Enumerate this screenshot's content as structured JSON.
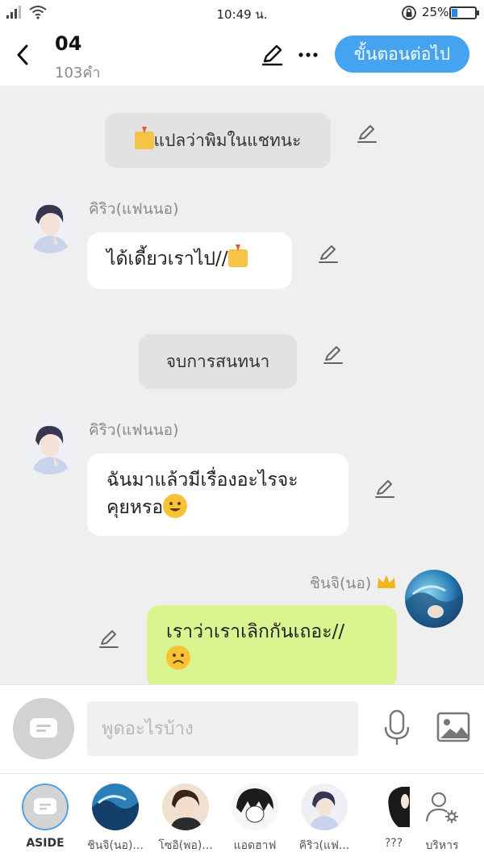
{
  "status_bar": {
    "time": "10:49 น.",
    "battery": "25%",
    "battery_level": 0.25
  },
  "header": {
    "title": "04",
    "subtitle": "103คำ",
    "next_label": "ขั้นตอนต่อไป"
  },
  "messages": [
    {
      "type": "narration",
      "text": "แปลว่าพิมในแชทนะ",
      "icon": "inbox-download-emoji"
    },
    {
      "type": "left",
      "name": "คิริว(แฟนนอ)",
      "text": "ได้เดี้ยวเราไป//",
      "icon": "inbox-download-emoji"
    },
    {
      "type": "narration",
      "text": "จบการสนทนา"
    },
    {
      "type": "left",
      "name": "คิริว(แฟนนอ)",
      "text_line1": "ฉันมาแล้วมีเรื่องอะไรจะ",
      "text_line2": "คุยหรอ",
      "icon": "smiling-face-emoji"
    },
    {
      "type": "right",
      "name": "ชินจิ(นอ)",
      "badge": "crown-emoji",
      "text_line1": "เราว่าเราเลิกกันเถอะ//",
      "icon": "frowning-face-emoji"
    }
  ],
  "input": {
    "placeholder": "พูดอะไรบ้าง"
  },
  "characters": [
    {
      "name": "ASIDE"
    },
    {
      "name": "ชินจิ(นอ)..."
    },
    {
      "name": "โซอิ(พอ)..."
    },
    {
      "name": "แอดฮาฟ"
    },
    {
      "name": "คิริว(แฟ..."
    },
    {
      "name": "???"
    },
    {
      "name": "บริหาร"
    }
  ],
  "colors": {
    "accent": "#45a3f0",
    "my_bubble": "#daf590",
    "narration_bg": "#e2e2e2"
  }
}
